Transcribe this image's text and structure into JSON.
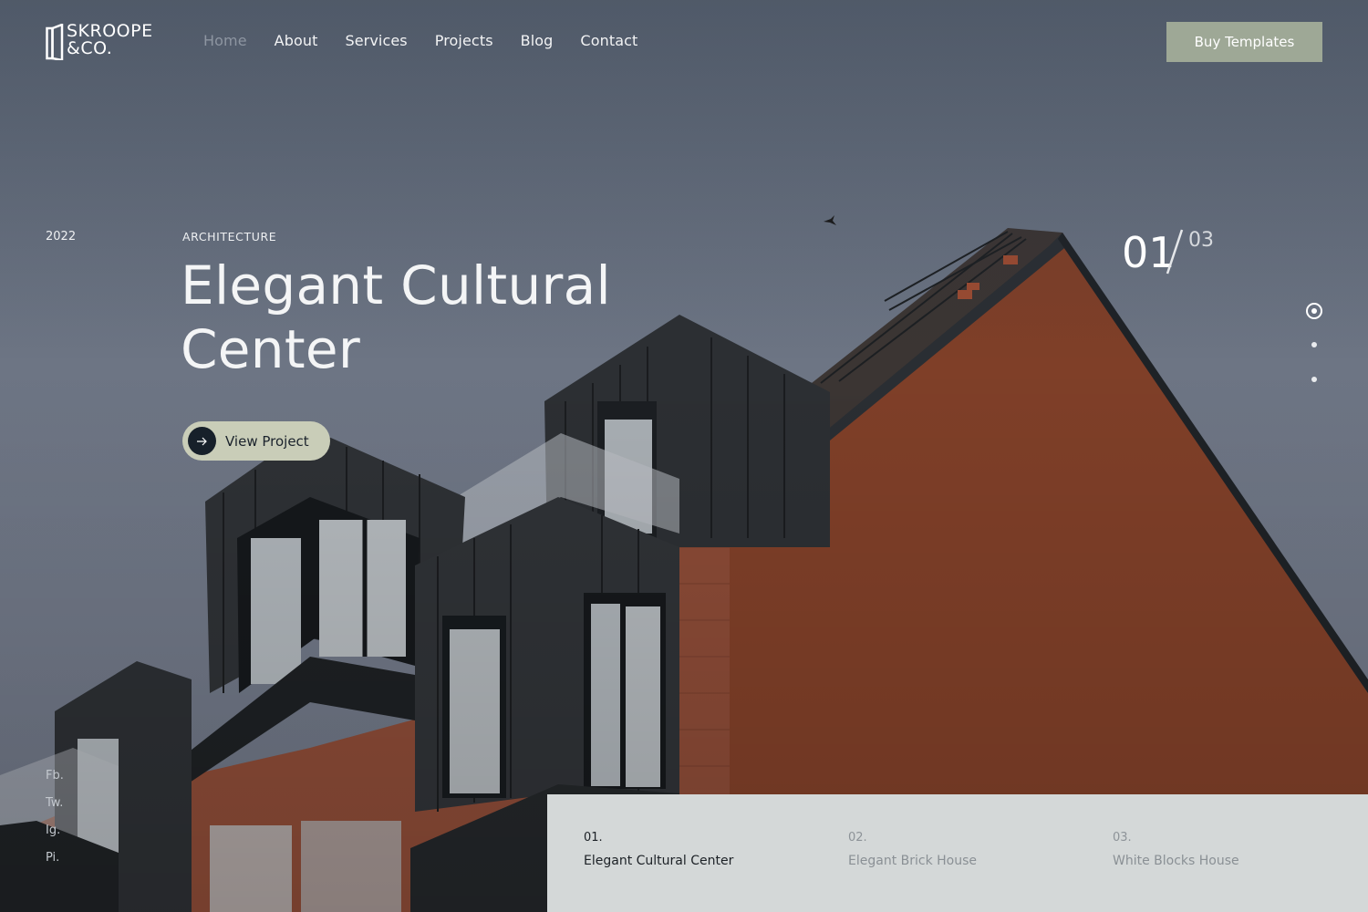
{
  "brand": {
    "line1": "SKROOPE",
    "line2": "&CO."
  },
  "nav": {
    "items": [
      {
        "label": "Home",
        "active": true
      },
      {
        "label": "About"
      },
      {
        "label": "Services"
      },
      {
        "label": "Projects"
      },
      {
        "label": "Blog"
      },
      {
        "label": "Contact"
      }
    ],
    "cta_label": "Buy Templates"
  },
  "hero": {
    "year": "2022",
    "category": "ARCHITECTURE",
    "title_line1": "Elegant Cultural",
    "title_line2": "Center",
    "button_label": "View Project",
    "button_icon": "arrow-right-icon"
  },
  "slider": {
    "current": "01",
    "total": "03",
    "active_index": 0,
    "dot_count": 3
  },
  "social": [
    "Fb.",
    "Tw.",
    "Ig.",
    "Pi."
  ],
  "projects": [
    {
      "number": "01.",
      "name": "Elegant Cultural Center",
      "active": true
    },
    {
      "number": "02.",
      "name": "Elegant Brick House"
    },
    {
      "number": "03.",
      "name": "White Blocks House"
    }
  ],
  "colors": {
    "accent_button": "#9ea896",
    "pill_button": "#c9cdb8",
    "panel": "#d4d8d8",
    "brick": "#8b4a32"
  }
}
